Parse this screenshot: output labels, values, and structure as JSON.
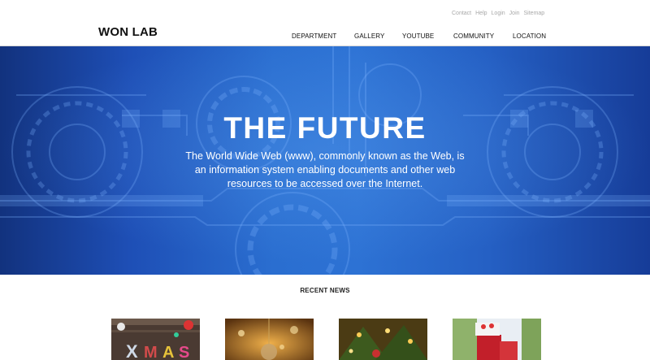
{
  "util_nav": [
    "Contact",
    "Help",
    "Login",
    "Join",
    "Sitemap"
  ],
  "header": {
    "logo": "WON LAB",
    "nav": [
      "DEPARTMENT",
      "GALLERY",
      "YOUTUBE",
      "COMMUNITY",
      "LOCATION"
    ]
  },
  "hero": {
    "title": "THE FUTURE",
    "description": "The World Wide Web (www), commonly known as the Web, is an information system enabling documents and other web resources to be accessed over the Internet."
  },
  "news": {
    "title": "RECENT NEWS",
    "thumbnails": [
      "xmas-letters-image",
      "christmas-ornament-image",
      "christmas-tree-image",
      "gift-box-image"
    ]
  },
  "colors": {
    "hero_blue": "#2a6ed0",
    "hero_dark": "#12327e",
    "util_text": "#a8a8a8"
  }
}
